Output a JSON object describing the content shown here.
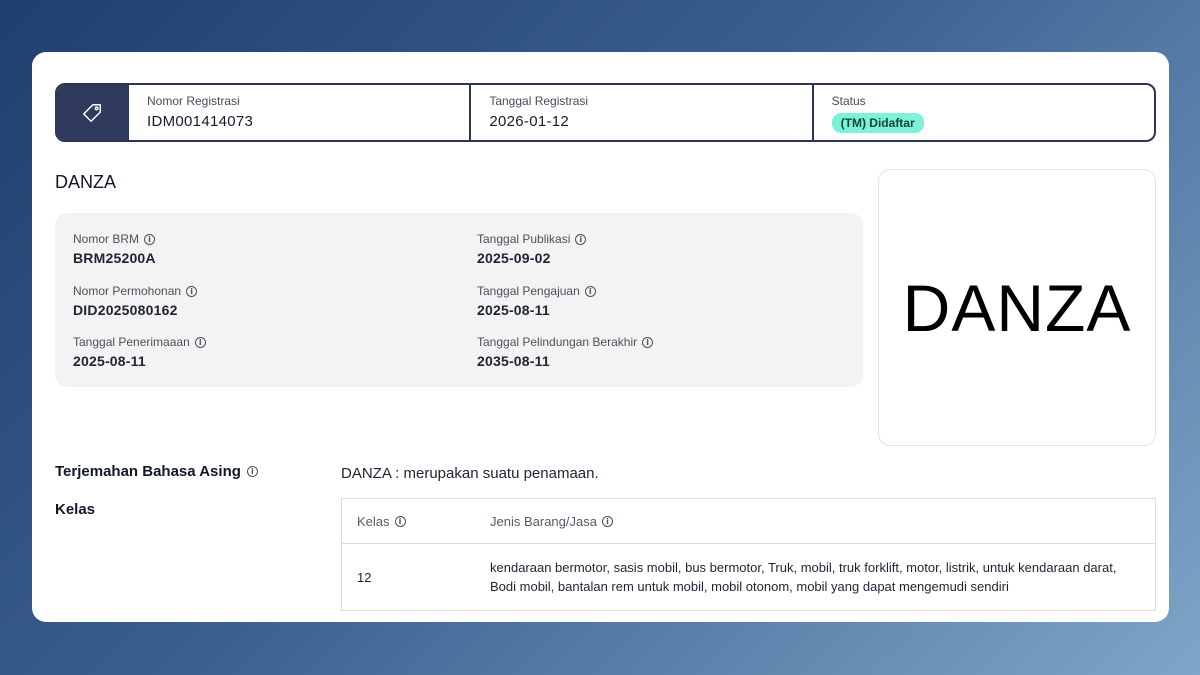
{
  "header": {
    "tag_icon": "tag-icon",
    "registration_number_label": "Nomor Registrasi",
    "registration_number": "IDM001414073",
    "registration_date_label": "Tanggal Registrasi",
    "registration_date": "2026-01-12",
    "status_label": "Status",
    "status_value": "(TM) Didaftar",
    "status_color": "#7ef2d6"
  },
  "mark_name": "DANZA",
  "details": {
    "brm_label": "Nomor BRM",
    "brm_value": "BRM25200A",
    "application_label": "Nomor Permohonan",
    "application_value": "DID2025080162",
    "receipt_label": "Tanggal Penerimaaan",
    "receipt_value": "2025-08-11",
    "publication_label": "Tanggal Publikasi",
    "publication_value": "2025-09-02",
    "filing_label": "Tanggal Pengajuan",
    "filing_value": "2025-08-11",
    "protection_end_label": "Tanggal Pelindungan Berakhir",
    "protection_end_value": "2035-08-11"
  },
  "logo_text": "DANZA",
  "translation": {
    "label": "Terjemahan Bahasa Asing",
    "value": "DANZA : merupakan suatu penamaan."
  },
  "classes": {
    "label": "Kelas",
    "col_class": "Kelas",
    "col_goods": "Jenis Barang/Jasa",
    "rows": [
      {
        "class": "12",
        "goods": "kendaraan bermotor, sasis mobil, bus bermotor, Truk, mobil, truk forklift, motor, listrik, untuk kendaraan darat, Bodi mobil, bantalan rem untuk mobil, mobil otonom, mobil yang dapat mengemudi sendiri"
      }
    ]
  }
}
